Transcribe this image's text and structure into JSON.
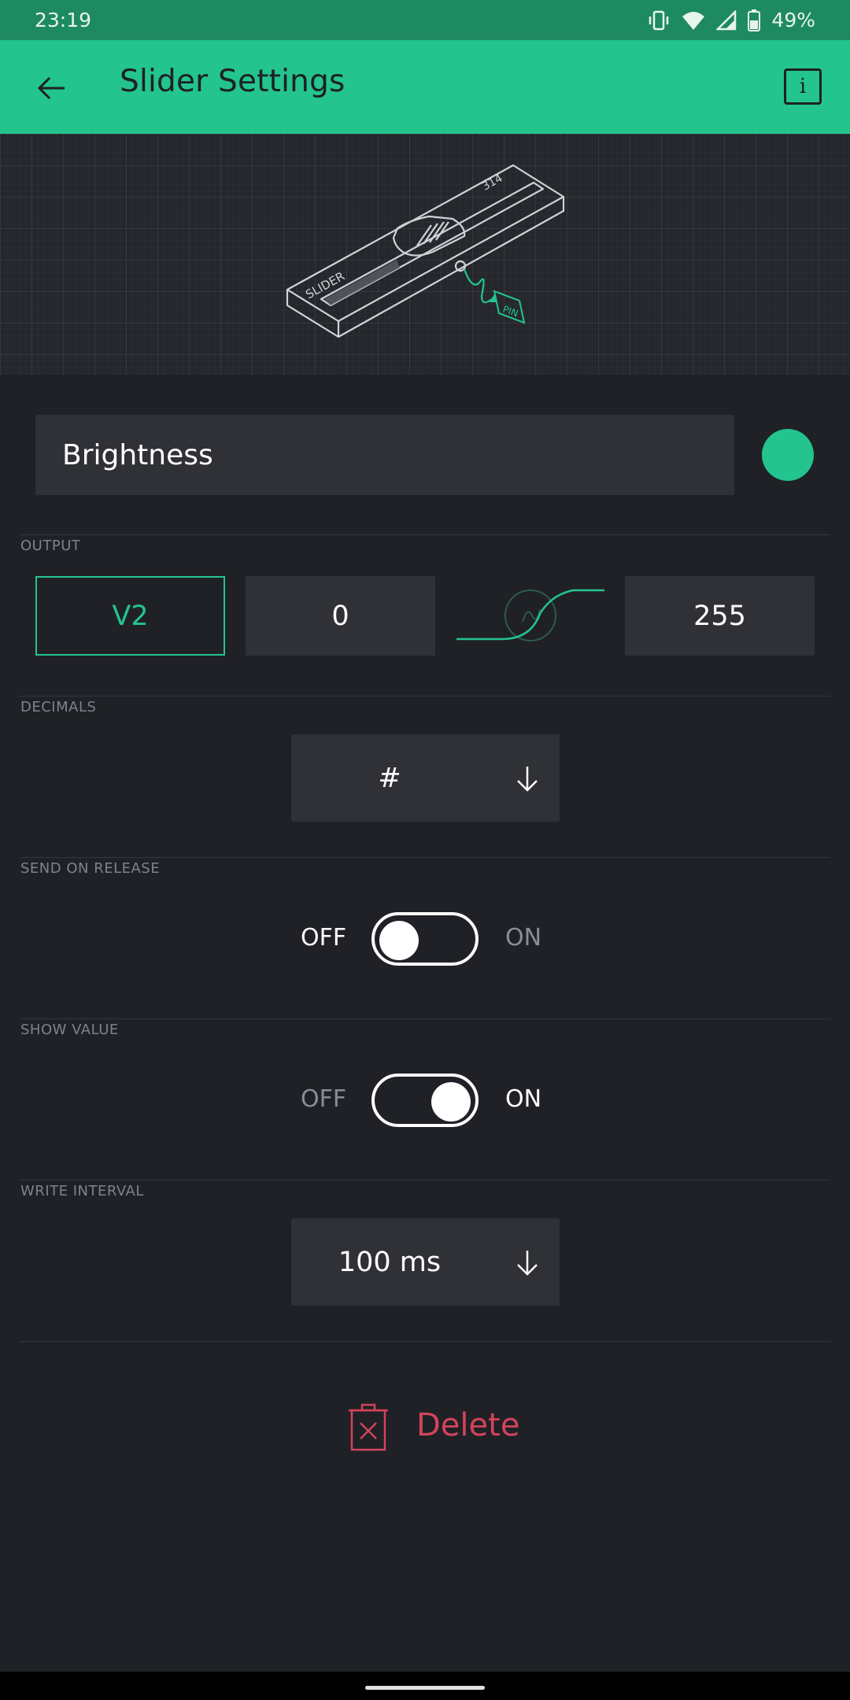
{
  "status_bar": {
    "time": "23:19",
    "battery": "49%"
  },
  "app_bar": {
    "title": "Slider Settings",
    "info_label": "i"
  },
  "widget": {
    "name": "Brightness",
    "color": "#23c48e"
  },
  "output": {
    "label": "OUTPUT",
    "pin": "V2",
    "min": "0",
    "max": "255"
  },
  "decimals": {
    "label": "DECIMALS",
    "value": "#"
  },
  "send_on_release": {
    "label": "SEND ON RELEASE",
    "off_label": "OFF",
    "on_label": "ON",
    "state": "off"
  },
  "show_value": {
    "label": "SHOW VALUE",
    "off_label": "OFF",
    "on_label": "ON",
    "state": "on"
  },
  "write_interval": {
    "label": "WRITE INTERVAL",
    "value": "100 ms"
  },
  "delete": {
    "label": "Delete"
  },
  "colors": {
    "accent": "#23c48e",
    "status_bar": "#1e8a62",
    "danger": "#d3435c",
    "background": "#1f2126"
  }
}
